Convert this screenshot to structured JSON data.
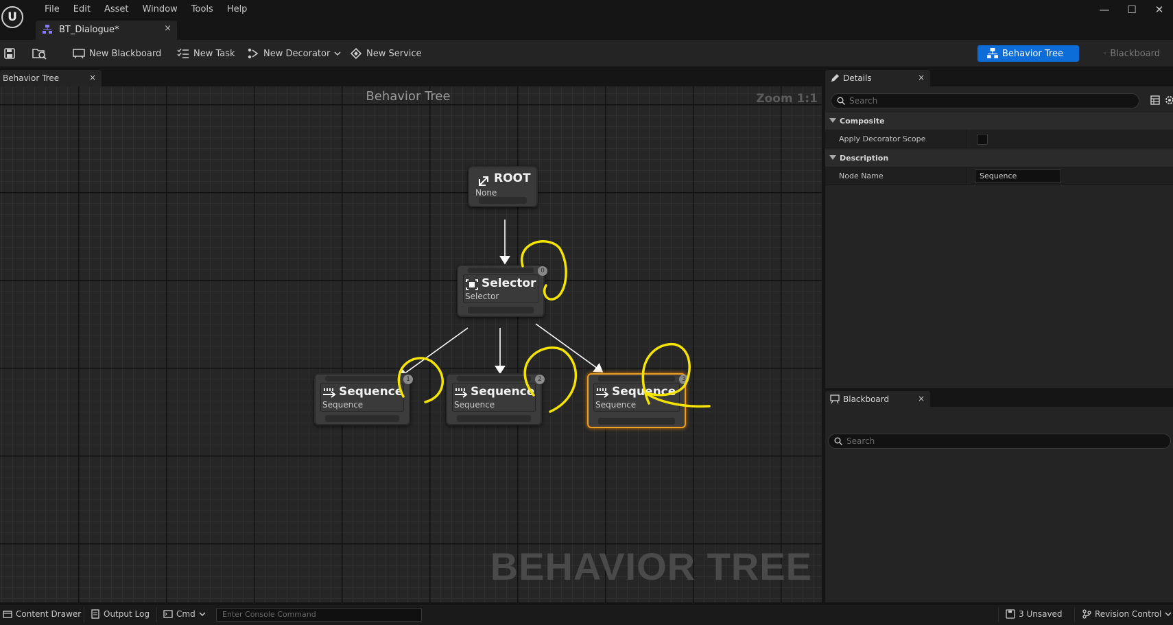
{
  "app": {
    "logo_text": "U",
    "menu": [
      "File",
      "Edit",
      "Asset",
      "Window",
      "Tools",
      "Help"
    ],
    "window_controls": {
      "minimize": "—",
      "maximize": "☐",
      "close": "✕"
    }
  },
  "document_tab": {
    "label": "BT_Dialogue*",
    "close": "×"
  },
  "toolbar": {
    "new_blackboard": "New Blackboard",
    "new_task": "New Task",
    "new_decorator": "New Decorator",
    "new_service": "New Service",
    "mode_behavior_tree": "Behavior Tree",
    "mode_blackboard": "Blackboard"
  },
  "graph": {
    "tab_label": "Behavior Tree",
    "tab_close": "×",
    "title": "Behavior Tree",
    "zoom": "Zoom 1:1",
    "watermark": "BEHAVIOR TREE",
    "nodes": {
      "root": {
        "title": "ROOT",
        "subtitle": "None"
      },
      "selector": {
        "title": "Selector",
        "subtitle": "Selector",
        "badge": "0"
      },
      "seq1": {
        "title": "Sequence",
        "subtitle": "Sequence",
        "badge": "1"
      },
      "seq2": {
        "title": "Sequence",
        "subtitle": "Sequence",
        "badge": "2"
      },
      "seq3": {
        "title": "Sequence",
        "subtitle": "Sequence",
        "badge": "3"
      }
    },
    "annotation_color": "#f5e400",
    "selection_color": "#f0a020"
  },
  "details": {
    "tab_label": "Details",
    "tab_close": "×",
    "search_placeholder": "Search",
    "sections": {
      "composite": {
        "label": "Composite",
        "apply_decorator_scope": "Apply Decorator Scope"
      },
      "description": {
        "label": "Description",
        "node_name_label": "Node Name",
        "node_name_value": "Sequence"
      }
    }
  },
  "blackboard": {
    "tab_label": "Blackboard",
    "tab_close": "×",
    "search_placeholder": "Search"
  },
  "statusbar": {
    "content_drawer": "Content Drawer",
    "output_log": "Output Log",
    "cmd": "Cmd",
    "console_placeholder": "Enter Console Command",
    "unsaved": "3 Unsaved",
    "revision_control": "Revision Control"
  }
}
